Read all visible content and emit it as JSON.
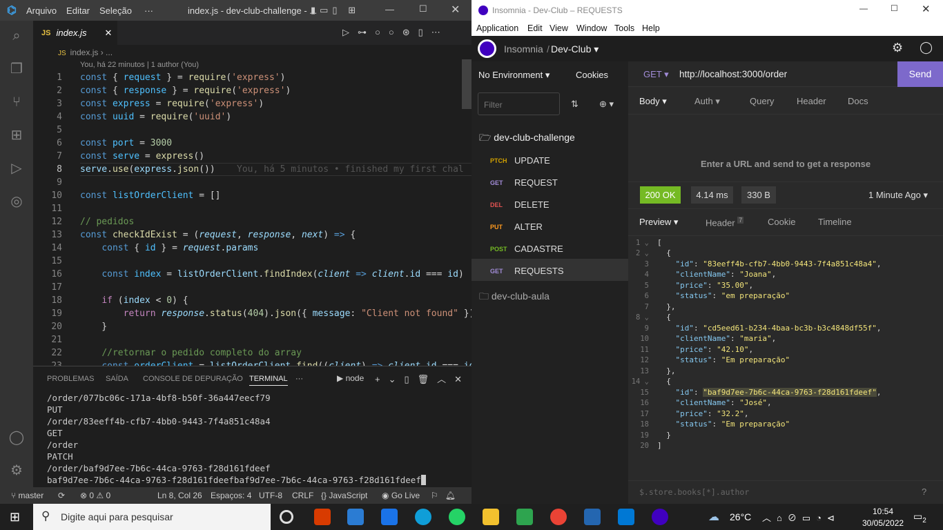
{
  "vscode": {
    "menu": [
      "Arquivo",
      "Editar",
      "Seleção",
      "···"
    ],
    "title": "index.js - dev-club-challenge - ...",
    "tab": "index.js",
    "breadcrumb": "index.js › ...",
    "blame_top": "You, há 22 minutos | 1 author (You)",
    "inline_blame": "You, há 5 minutos • finished my first chal",
    "lines": [
      "1",
      "2",
      "3",
      "4",
      "5",
      "6",
      "7",
      "8",
      "9",
      "10",
      "11",
      "12",
      "13",
      "14",
      "15",
      "16",
      "17",
      "18",
      "19",
      "20",
      "21",
      "22",
      "23"
    ],
    "panel_tabs": [
      "PROBLEMAS",
      "SAÍDA",
      "CONSOLE DE DEPURAÇÃO",
      "TERMINAL",
      "···"
    ],
    "terminal_shell": "node",
    "terminal": [
      "/order/077bc06c-171a-4bf8-b50f-36a447eecf79",
      "PUT",
      "/order/83eeff4b-cfb7-4bb0-9443-7f4a851c48a4",
      "GET",
      "/order",
      "PATCH",
      "/order/baf9d7ee-7b6c-44ca-9763-f28d161fdeef",
      "baf9d7ee-7b6c-44ca-9763-f28d161fdeefbaf9d7ee-7b6c-44ca-9763-f28d161fdeef"
    ],
    "status": {
      "branch": "master",
      "errors": "0",
      "warnings": "0",
      "pos": "Ln 8, Col 26",
      "spaces": "Espaços: 4",
      "enc": "UTF-8",
      "eol": "CRLF",
      "lang": "{} JavaScript",
      "live": "Go Live"
    }
  },
  "insomnia": {
    "title": "Insomnia - Dev-Club – REQUESTS",
    "menu": [
      "Application",
      "Edit",
      "View",
      "Window",
      "Tools",
      "Help"
    ],
    "app": "Insomnia",
    "workspace": "Dev-Club",
    "env": "No Environment",
    "cookies": "Cookies",
    "filter": "Filter",
    "folder1": "dev-club-challenge",
    "folder2": "dev-club-aula",
    "requests": [
      {
        "m": "PTCH",
        "n": "UPDATE",
        "c": "#d0a000"
      },
      {
        "m": "GET",
        "n": "REQUEST",
        "c": "#a28cd8"
      },
      {
        "m": "DEL",
        "n": "DELETE",
        "c": "#e15251"
      },
      {
        "m": "PUT",
        "n": "ALTER",
        "c": "#ff9a1f"
      },
      {
        "m": "POST",
        "n": "CADASTRE",
        "c": "#75ba24"
      },
      {
        "m": "GET",
        "n": "REQUESTS",
        "c": "#a28cd8"
      }
    ],
    "method": "GET",
    "url": "http://localhost:3000/order",
    "send": "Send",
    "req_tabs": [
      "Body",
      "Auth",
      "Query",
      "Header",
      "Docs"
    ],
    "empty": "Enter a URL and send to get a response",
    "status": "200 OK",
    "time": "4.14 ms",
    "size": "330 B",
    "ago": "1 Minute Ago",
    "resp_tabs": [
      "Preview",
      "Header",
      "Cookie",
      "Timeline"
    ],
    "header_count": "7",
    "filter_hint": "$.store.books[*].author"
  },
  "taskbar": {
    "search": "Digite aqui para pesquisar",
    "temp": "26°C",
    "time": "10:54",
    "date": "30/05/2022",
    "notif": "2"
  }
}
